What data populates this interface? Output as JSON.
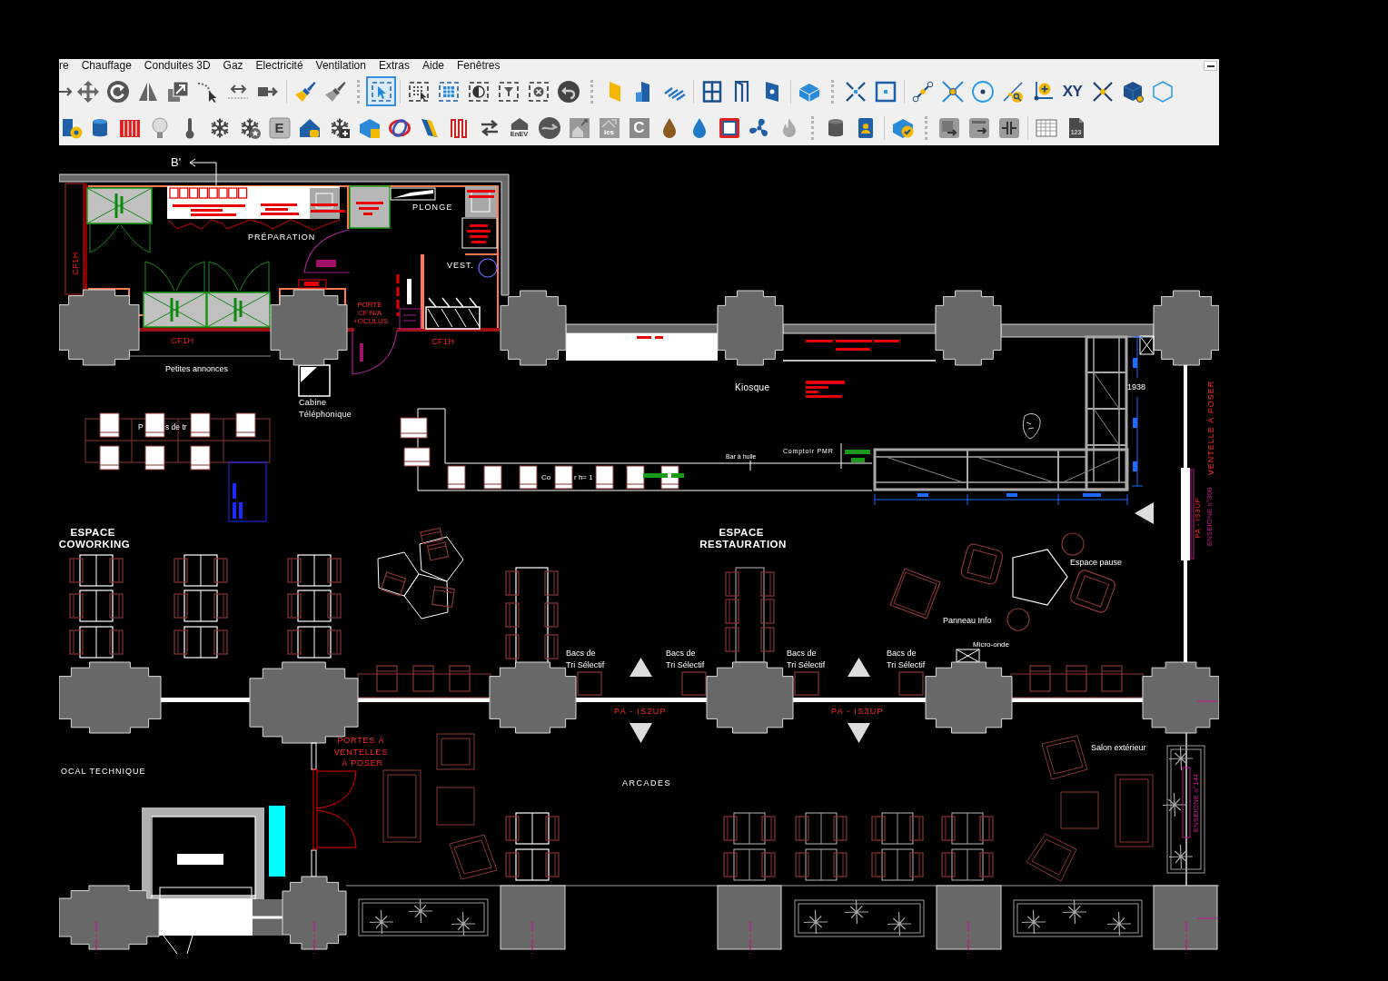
{
  "menu": [
    "re",
    "Chauffage",
    "Conduites 3D",
    "Gaz",
    "Electricité",
    "Ventilation",
    "Extras",
    "Aide",
    "Fenêtres"
  ],
  "toolbars": [
    {
      "buttons": [
        {
          "selected": false
        },
        {
          "selected": false
        },
        {
          "selected": false
        },
        {
          "selected": false
        },
        {
          "selected": false
        },
        {
          "selected": false
        },
        {
          "selected": false
        },
        {
          "selected": false
        },
        {
          "selected": false
        },
        {
          "selected": false
        },
        {
          "selected": true
        },
        {
          "selected": false
        },
        {
          "selected": false
        },
        {
          "selected": false
        },
        {
          "selected": false
        },
        {
          "selected": false
        },
        {
          "selected": false
        },
        {
          "selected": false
        },
        {
          "selected": false
        },
        {
          "selected": false
        },
        {
          "selected": false
        },
        {
          "selected": false
        },
        {
          "selected": false
        },
        {
          "selected": false
        },
        {
          "selected": false
        },
        {
          "selected": false
        },
        {
          "selected": false
        },
        {
          "selected": false
        },
        {
          "selected": false
        },
        {
          "selected": false
        },
        {
          "selected": false
        },
        {
          "selected": false,
          "text": "XY"
        },
        {
          "selected": false
        },
        {
          "selected": false
        },
        {
          "selected": false
        }
      ]
    },
    {
      "buttons": [
        {
          "selected": false
        },
        {
          "selected": false
        },
        {
          "selected": false
        },
        {
          "selected": false
        },
        {
          "selected": false
        },
        {
          "selected": false
        },
        {
          "selected": false
        },
        {
          "selected": false,
          "text": "E"
        },
        {
          "selected": false
        },
        {
          "selected": false
        },
        {
          "selected": false
        },
        {
          "selected": false
        },
        {
          "selected": false
        },
        {
          "selected": false
        },
        {
          "selected": false
        },
        {
          "selected": false,
          "text": "EnEV"
        },
        {
          "selected": false
        },
        {
          "selected": false
        },
        {
          "selected": false,
          "text": "ies"
        },
        {
          "selected": false,
          "text": "C"
        },
        {
          "selected": false
        },
        {
          "selected": false
        },
        {
          "selected": false
        },
        {
          "selected": false
        },
        {
          "selected": false
        },
        {
          "selected": false
        },
        {
          "selected": false
        },
        {
          "selected": false
        },
        {
          "selected": false
        },
        {
          "selected": false
        },
        {
          "selected": false
        },
        {
          "selected": false
        },
        {
          "selected": false,
          "text": "123"
        }
      ]
    }
  ],
  "drawing": {
    "labels": [
      {
        "kind": "marker",
        "text": "B'"
      },
      {
        "kind": "room",
        "text": "PRÉPARATION"
      },
      {
        "kind": "room",
        "text": "PLONGE"
      },
      {
        "kind": "room",
        "text": "VEST."
      },
      {
        "kind": "rating",
        "text": "CF1H"
      },
      {
        "kind": "annotation",
        "lines": [
          "PORTE",
          "CF N/A",
          "+OCULUS"
        ]
      },
      {
        "kind": "rating",
        "text": "CF1H"
      },
      {
        "kind": "rating",
        "text": "CF1H"
      },
      {
        "kind": "note",
        "text": "Petites annonces"
      },
      {
        "kind": "note",
        "lines": [
          "Cabine",
          "Téléphonique"
        ]
      },
      {
        "kind": "note",
        "text": "P"
      },
      {
        "kind": "note",
        "text": "s de tr"
      },
      {
        "kind": "note",
        "text": "Kiosque"
      },
      {
        "kind": "dimension",
        "text": "1938"
      },
      {
        "kind": "annotation",
        "text": "VENTELLE À POSER"
      },
      {
        "kind": "note",
        "text": "Comptoir PMR"
      },
      {
        "kind": "note",
        "text": "Bar à huile"
      },
      {
        "kind": "note",
        "text": "Co"
      },
      {
        "kind": "note",
        "text": "r h= 1"
      },
      {
        "kind": "annotation",
        "text": "PA - IS3UP"
      },
      {
        "kind": "sign",
        "text": "ENSEIGNE n°300"
      },
      {
        "kind": "title",
        "lines": [
          "ESPACE",
          "COWORKING"
        ]
      },
      {
        "kind": "title",
        "lines": [
          "ESPACE",
          "RESTAURATION"
        ]
      },
      {
        "kind": "note",
        "text": "Espace pause"
      },
      {
        "kind": "note",
        "text": "Panneau Info"
      },
      {
        "kind": "note",
        "text": "Micro-onde"
      },
      {
        "kind": "note",
        "lines": [
          "Bacs de",
          "Tri Sélectif"
        ]
      },
      {
        "kind": "note",
        "lines": [
          "Bacs de",
          "Tri Sélectif"
        ]
      },
      {
        "kind": "note",
        "lines": [
          "Bacs de",
          "Tri Sélectif"
        ]
      },
      {
        "kind": "note",
        "lines": [
          "Bacs de",
          "Tri Sélectif"
        ]
      },
      {
        "kind": "annotation",
        "text": "PA - IS2UP"
      },
      {
        "kind": "annotation",
        "text": "PA - IS3UP"
      },
      {
        "kind": "annotation",
        "lines": [
          "PORTES À",
          "VENTELLES",
          "À POSER"
        ]
      },
      {
        "kind": "note",
        "text": "Salon extérieur"
      },
      {
        "kind": "room",
        "text": "OCAL TECHNIQUE"
      },
      {
        "kind": "room",
        "text": "ARCADES"
      },
      {
        "kind": "sign",
        "text": "ENSEIGNE n°144"
      }
    ]
  }
}
